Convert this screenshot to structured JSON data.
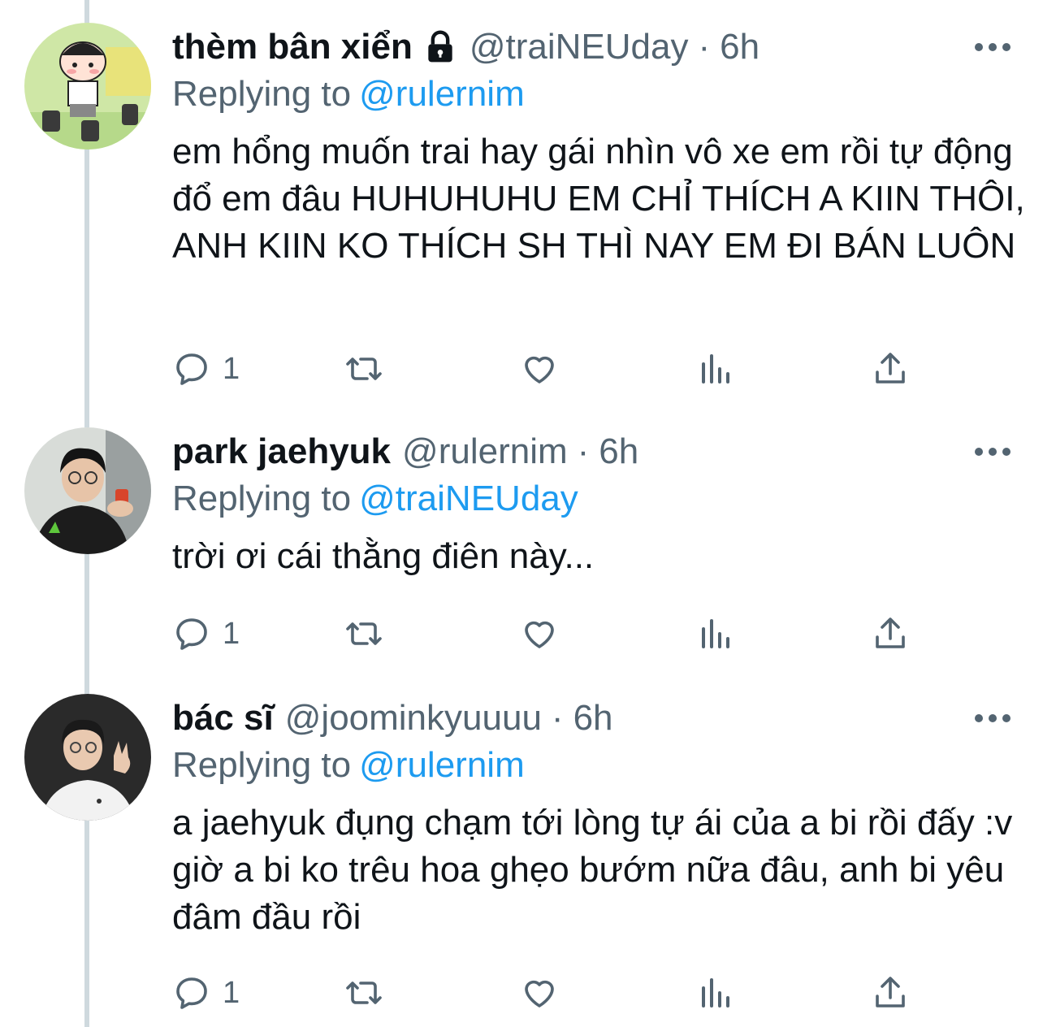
{
  "colors": {
    "accent": "#1d9bf0",
    "secondary_text": "#536471",
    "thread_line": "#cfd9de"
  },
  "tweets": [
    {
      "name": "thèm bân xiển",
      "locked": true,
      "handle": "@traiNEUday",
      "separator": "·",
      "time": "6h",
      "replying_label": "Replying to",
      "replying_to": "@rulernim",
      "text": "em hổng muốn trai hay gái nhìn vô xe em rồi tự động đổ em đâu HUHUHUHU EM CHỈ THÍCH A KIIN THÔI, ANH KIIN KO THÍCH SH THÌ NAY EM ĐI BÁN LUÔN",
      "reply_count": "1",
      "avatar_icon": "cartoon-character-avatar"
    },
    {
      "name": "park jaehyuk",
      "locked": false,
      "handle": "@rulernim",
      "separator": "·",
      "time": "6h",
      "replying_label": "Replying to",
      "replying_to": "@traiNEUday",
      "text": "trời ơi cái thằng điên này...",
      "reply_count": "1",
      "avatar_icon": "person-photo-avatar"
    },
    {
      "name": "bác sĩ",
      "locked": false,
      "handle": "@joominkyuuuu",
      "separator": "·",
      "time": "6h",
      "replying_label": "Replying to",
      "replying_to": "@rulernim",
      "text": "a jaehyuk đụng chạm tới lòng tự ái của a bi rồi đấy :v giờ a bi ko trêu hoa ghẹo bướm nữa đâu, anh bi yêu đâm đầu rồi",
      "reply_count": "1",
      "avatar_icon": "person-photo-avatar"
    }
  ],
  "action_icons": [
    "reply-icon",
    "retweet-icon",
    "like-icon",
    "views-icon",
    "share-icon"
  ]
}
